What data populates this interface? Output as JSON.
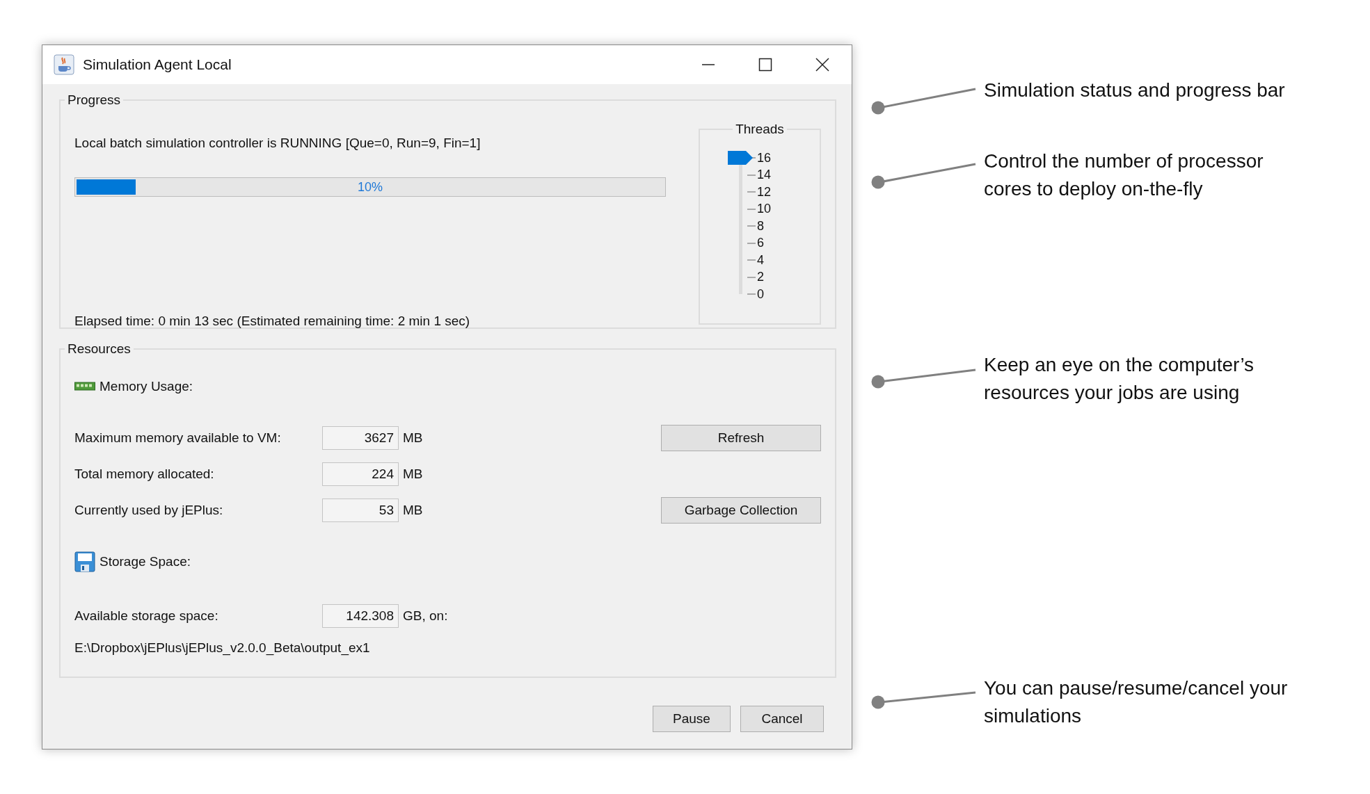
{
  "window": {
    "title": "Simulation Agent Local"
  },
  "progress": {
    "title": "Progress",
    "status": "Local batch simulation controller is RUNNING [Que=0, Run=9, Fin=1]",
    "level": 0.1,
    "percent": "10%",
    "elapsed": "Elapsed time: 0 min 13 sec (Estimated remaining time: 2 min 1 sec)"
  },
  "threads": {
    "title": "Threads",
    "level": 1,
    "ticks": [
      "16",
      "14",
      "12",
      "10",
      "8",
      "6",
      "4",
      "2",
      "0"
    ]
  },
  "resources": {
    "title": "Resources",
    "memory_heading": "Memory Usage:",
    "memory_rows": [
      {
        "label": "Maximum memory available to VM:",
        "value": "3627",
        "unit": "MB",
        "button": "Refresh"
      },
      {
        "label": "Total memory allocated:",
        "value": "224",
        "unit": "MB"
      },
      {
        "label": "Currently used by jEPlus:",
        "value": "53",
        "unit": "MB",
        "button": "Garbage Collection"
      }
    ],
    "storage_heading": "Storage Space:",
    "storage": {
      "label": "Available storage space:",
      "value": "142.308",
      "unit": "GB, on:"
    },
    "path": "E:\\Dropbox\\jEPlus\\jEPlus_v2.0.0_Beta\\output_ex1"
  },
  "buttons": [
    "Pause",
    "Cancel"
  ],
  "annotations": [
    {
      "text": "Simulation status and progress bar"
    },
    {
      "text": "Control the number of processor cores to deploy on-the-fly"
    },
    {
      "text": "Keep an eye on the computer’s resources your jobs are using"
    },
    {
      "text": "You can pause/resume/cancel your simulations"
    }
  ]
}
